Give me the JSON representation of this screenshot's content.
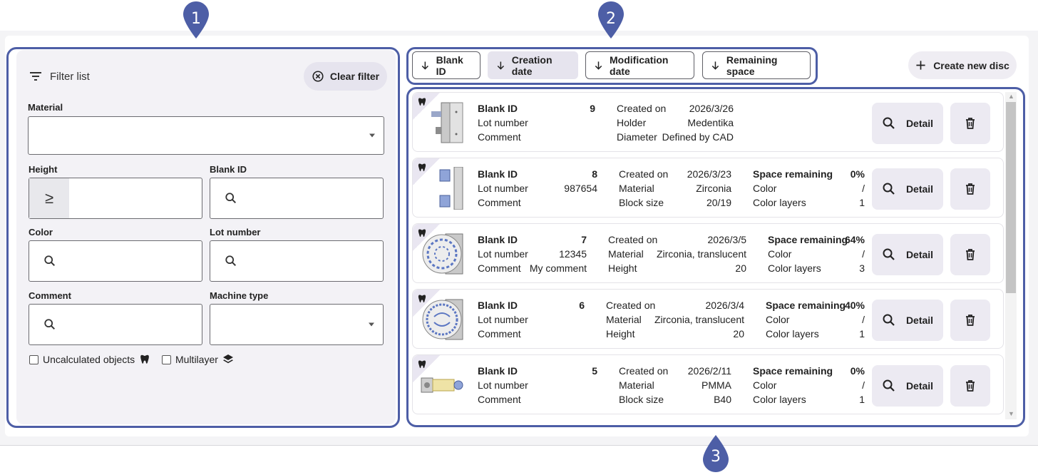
{
  "filter": {
    "title": "Filter list",
    "clear_label": "Clear filter",
    "material_label": "Material",
    "height_label": "Height",
    "height_prefix": "≥",
    "blank_id_label": "Blank ID",
    "color_label": "Color",
    "lot_label": "Lot number",
    "comment_label": "Comment",
    "machine_label": "Machine type",
    "uncalculated_label": "Uncalculated objects",
    "multilayer_label": "Multilayer"
  },
  "sort": {
    "blank_id": "Blank ID",
    "creation_date": "Creation date",
    "modification_date": "Modification date",
    "remaining_space": "Remaining space"
  },
  "create_label": "Create new disc",
  "detail_label": "Detail",
  "callouts": [
    "1",
    "2",
    "3"
  ],
  "labels": {
    "blank_id": "Blank ID",
    "lot_number": "Lot number",
    "comment": "Comment",
    "created_on": "Created on",
    "holder": "Holder",
    "diameter": "Diameter",
    "material": "Material",
    "block_size": "Block size",
    "height": "Height",
    "space_remaining": "Space remaining",
    "color": "Color",
    "color_layers": "Color layers"
  },
  "rows": [
    {
      "blank_id": "9",
      "lot": "",
      "comment": "",
      "created": "2026/3/26",
      "mid2_label": "Holder",
      "mid2": "Medentika",
      "mid3_label": "Diameter",
      "mid3": "Defined by CAD",
      "space": "",
      "color": "",
      "layers": ""
    },
    {
      "blank_id": "8",
      "lot": "987654",
      "comment": "",
      "created": "2026/3/23",
      "mid2_label": "Material",
      "mid2": "Zirconia",
      "mid3_label": "Block size",
      "mid3": "20/19",
      "space": "0%",
      "color": "/",
      "layers": "1"
    },
    {
      "blank_id": "7",
      "lot": "12345",
      "comment": "My comment",
      "created": "2026/3/5",
      "mid2_label": "Material",
      "mid2": "Zirconia, translucent",
      "mid3_label": "Height",
      "mid3": "20",
      "space": "64%",
      "color": "/",
      "layers": "3"
    },
    {
      "blank_id": "6",
      "lot": "",
      "comment": "",
      "created": "2026/3/4",
      "mid2_label": "Material",
      "mid2": "Zirconia, translucent",
      "mid3_label": "Height",
      "mid3": "20",
      "space": "40%",
      "color": "/",
      "layers": "1"
    },
    {
      "blank_id": "5",
      "lot": "",
      "comment": "",
      "created": "2026/2/11",
      "mid2_label": "Material",
      "mid2": "PMMA",
      "mid3_label": "Block size",
      "mid3": "B40",
      "space": "0%",
      "color": "/",
      "layers": "1"
    }
  ],
  "colors": {
    "accent": "#4d5ea6",
    "tonal": "#e6e4ee",
    "panel": "#f3f2f6"
  },
  "icons": [
    "filter-icon",
    "close-circle-icon",
    "search-icon",
    "arrow-down-icon",
    "plus-icon",
    "trash-icon",
    "tooth-icon",
    "layers-icon"
  ]
}
